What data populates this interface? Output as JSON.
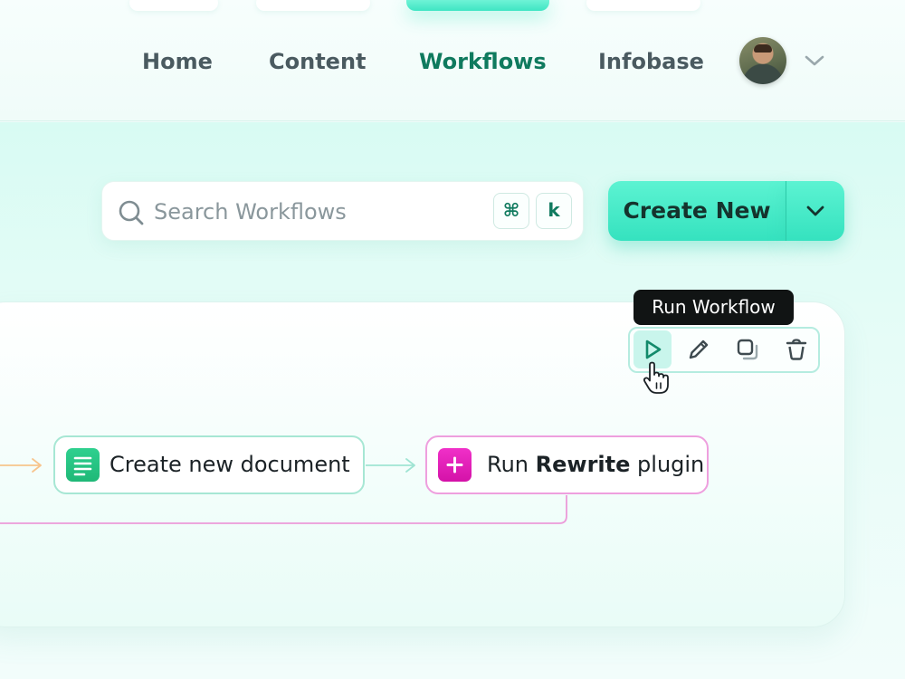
{
  "nav": {
    "items": [
      {
        "label": "Home",
        "active": false
      },
      {
        "label": "Content",
        "active": false
      },
      {
        "label": "Workflows",
        "active": true
      },
      {
        "label": "Infobase",
        "active": false
      }
    ],
    "avatar_icon": "user-avatar",
    "menu_icon": "chevron-down-icon"
  },
  "search": {
    "placeholder": "Search Workflows",
    "value": "",
    "shortcut_keys": [
      "⌘",
      "k"
    ],
    "icon": "search-icon"
  },
  "actions": {
    "create_label": "Create New",
    "dropdown_icon": "chevron-down-icon"
  },
  "workflow_card": {
    "tooltip": "Run Workflow",
    "toolbar": [
      {
        "action": "run",
        "icon": "play-icon",
        "active": true
      },
      {
        "action": "edit",
        "icon": "pencil-icon",
        "active": false
      },
      {
        "action": "duplicate",
        "icon": "copy-icon",
        "active": false
      },
      {
        "action": "delete",
        "icon": "trash-icon",
        "active": false
      }
    ],
    "nodes": [
      {
        "label": "Create new document",
        "icon": "document-icon"
      },
      {
        "label_prefix": "Run ",
        "label_bold": "Rewrite",
        "label_suffix": " plugin",
        "icon": "plus-icon"
      }
    ]
  },
  "colors": {
    "accent": "#3fe5c3",
    "active_nav": "#0f7a5e",
    "document_node": "#1fb877",
    "plugin_node": "#d412a8",
    "tooltip_bg": "#111414"
  }
}
